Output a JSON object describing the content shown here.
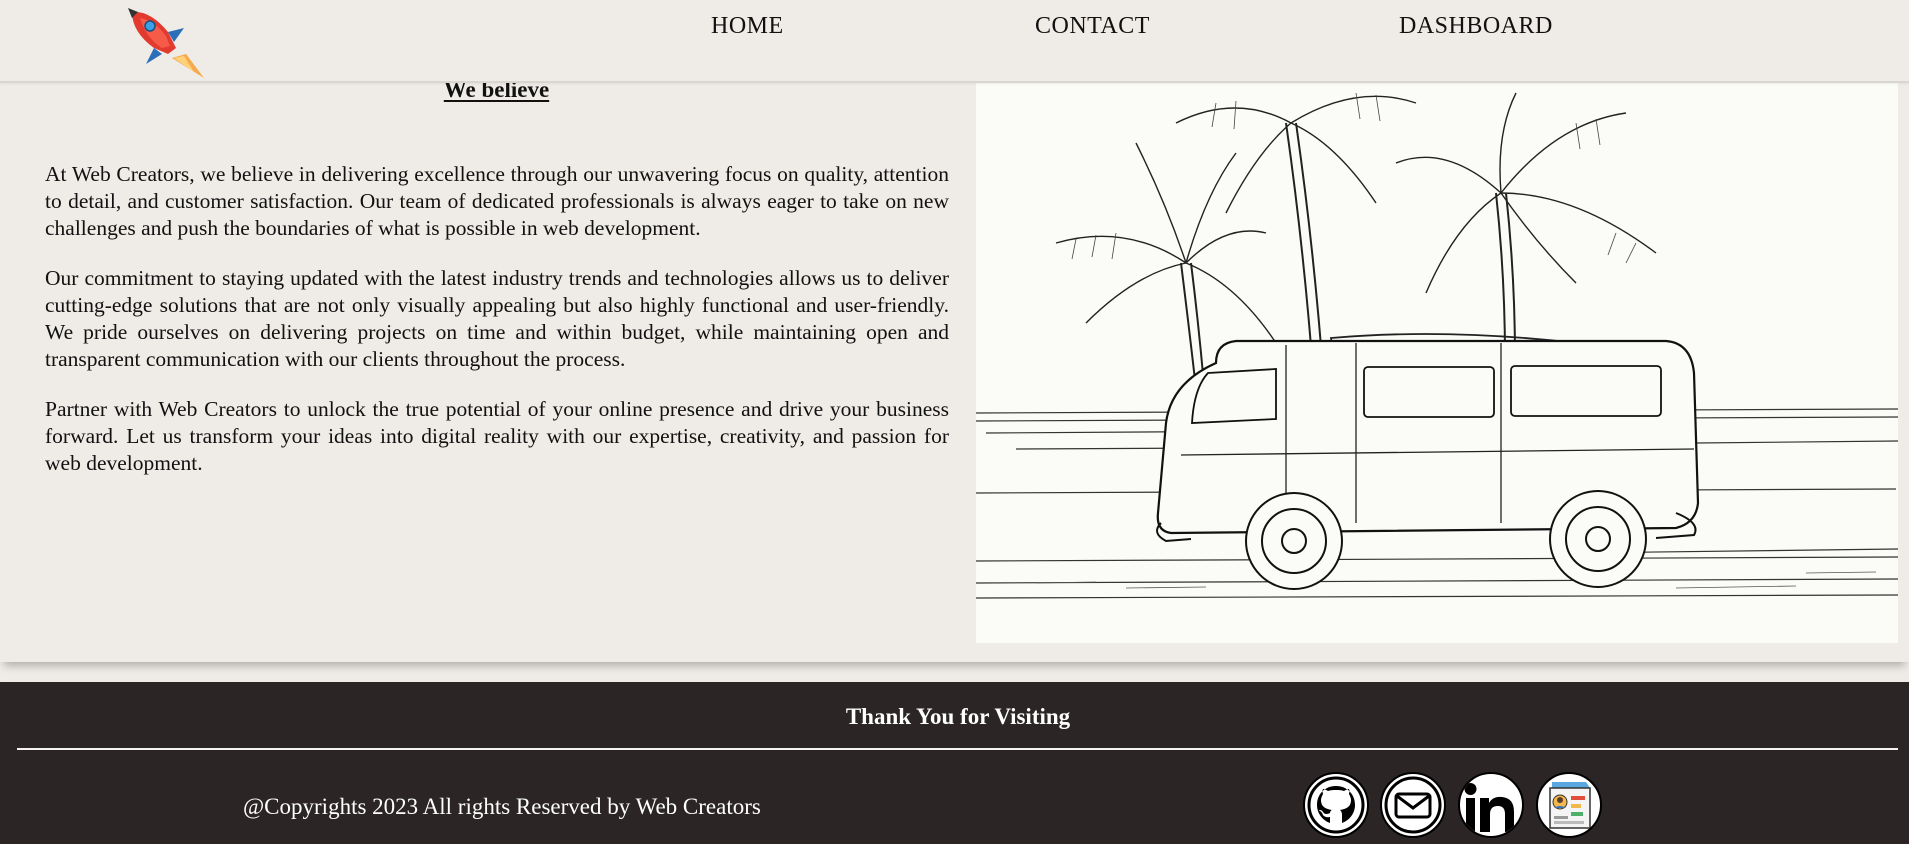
{
  "nav": {
    "home": "HOME",
    "contact": "CONTACT",
    "dashboard": "DASHBOARD",
    "logo_icon": "rocket-logo-icon"
  },
  "about": {
    "title": "We believe",
    "paragraphs": [
      "At Web Creators, we believe in delivering excellence through our unwavering focus on quality, attention to detail, and customer satisfaction. Our team of dedicated professionals is always eager to take on new challenges and push the boundaries of what is possible in web development.",
      "Our commitment to staying updated with the latest industry trends and technologies allows us to deliver cutting-edge solutions that are not only visually appealing but also highly functional and user-friendly. We pride ourselves on delivering projects on time and within budget, while maintaining open and transparent communication with our clients throughout the process.",
      "Partner with Web Creators to unlock the true potential of your online presence and drive your business forward. Let us transform your ideas into digital reality with our expertise, creativity, and passion for web development."
    ]
  },
  "footer": {
    "title": "Thank You for Visiting",
    "copyright": "@Copyrights 2023 All rights Reserved by Web Creators",
    "social_icons": [
      "github-icon",
      "mail-icon",
      "linkedin-icon",
      "resume-icon"
    ]
  },
  "colors": {
    "page_bg": "#efebe6",
    "footer_bg": "#2b2525",
    "text": "#111111",
    "footer_text": "#ffffff"
  }
}
